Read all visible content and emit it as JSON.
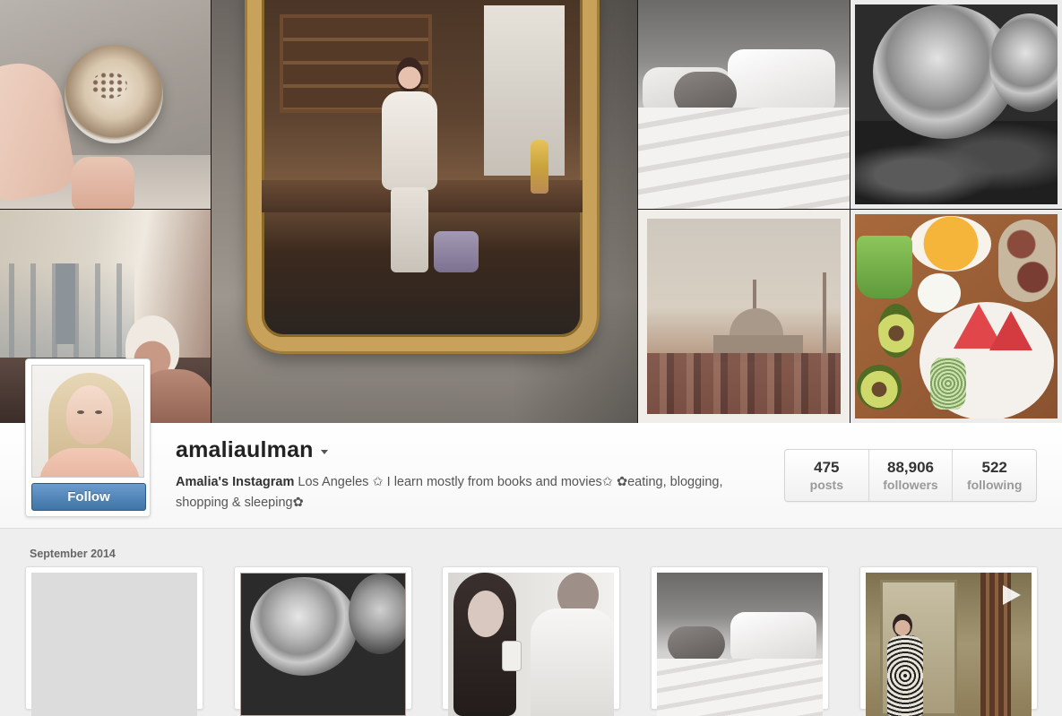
{
  "profile": {
    "username": "amaliaulman",
    "follow_label": "Follow",
    "bio": {
      "full_name": "Amalia's Instagram",
      "text": " Los Angeles ✩ I learn mostly from books and movies✩ ✿eating, blogging, shopping & sleeping✿"
    },
    "stats": [
      {
        "count": "475",
        "label": "posts"
      },
      {
        "count": "88,906",
        "label": "followers"
      },
      {
        "count": "522",
        "label": "following"
      }
    ]
  },
  "feed": {
    "section_title": "September 2014"
  },
  "icons": {
    "dropdown": "chevron-down-icon",
    "video": "play-icon"
  },
  "colors": {
    "follow_button": "#3f74a6",
    "background": "#eeeeee"
  }
}
